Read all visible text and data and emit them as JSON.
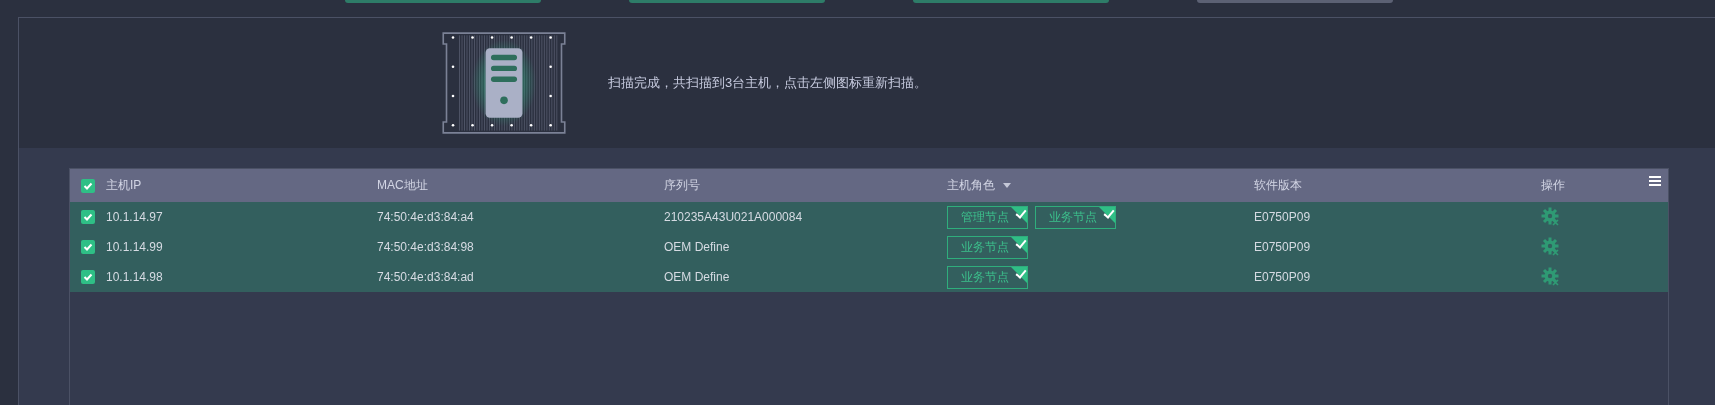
{
  "top_buttons": [
    {
      "kind": "primary"
    },
    {
      "kind": "primary"
    },
    {
      "kind": "primary"
    },
    {
      "kind": "secondary"
    }
  ],
  "scan": {
    "message": "扫描完成，共扫描到3台主机，点击左侧图标重新扫描。"
  },
  "table": {
    "all_checked": true,
    "columns": [
      {
        "label": "主机IP"
      },
      {
        "label": "MAC地址"
      },
      {
        "label": "序列号"
      },
      {
        "label": "主机角色",
        "sortable": true
      },
      {
        "label": "软件版本"
      },
      {
        "label": "操作"
      }
    ],
    "rows": [
      {
        "checked": true,
        "ip": "10.1.14.97",
        "mac": "74:50:4e:d3:84:a4",
        "serial": "210235A43U021A000084",
        "roles": [
          {
            "label": "管理节点",
            "checked": true
          },
          {
            "label": "业务节点",
            "checked": true
          }
        ],
        "version": "E0750P09"
      },
      {
        "checked": true,
        "ip": "10.1.14.99",
        "mac": "74:50:4e:d3:84:98",
        "serial": "OEM Define",
        "roles": [
          {
            "label": "业务节点",
            "checked": true
          }
        ],
        "version": "E0750P09"
      },
      {
        "checked": true,
        "ip": "10.1.14.98",
        "mac": "74:50:4e:d3:84:ad",
        "serial": "OEM Define",
        "roles": [
          {
            "label": "业务节点",
            "checked": true
          }
        ],
        "version": "E0750P09"
      }
    ]
  }
}
